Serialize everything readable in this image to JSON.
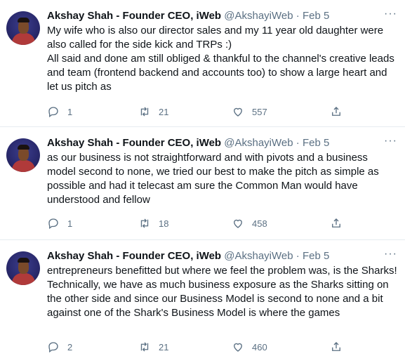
{
  "tweets": [
    {
      "name": "Akshay Shah - Founder CEO, iWeb",
      "handle": "@AkshayiWeb",
      "separator": "·",
      "date": "Feb 5",
      "lines": [
        "My wife who is also our director sales and my 11 year old daughter were also called for the side kick and TRPs :)",
        "All said and done am still obliged & thankful to the channel's creative leads and team (frontend backend and accounts too) to show a large heart and let us pitch as"
      ],
      "replies": "1",
      "retweets": "21",
      "likes": "557"
    },
    {
      "name": "Akshay Shah - Founder CEO, iWeb",
      "handle": "@AkshayiWeb",
      "separator": "·",
      "date": "Feb 5",
      "lines": [
        "as our business is not straightforward and with pivots and a business model second to none, we tried our best to make the pitch as simple as possible and had it telecast am sure the Common Man would have understood and fellow"
      ],
      "replies": "1",
      "retweets": "18",
      "likes": "458"
    },
    {
      "name": "Akshay Shah - Founder CEO, iWeb",
      "handle": "@AkshayiWeb",
      "separator": "·",
      "date": "Feb 5",
      "lines": [
        "entrepreneurs benefitted but where we feel the problem was, is the Sharks!",
        "Technically, we have as much business exposure as the Sharks sitting on the other side and since our Business Model is second to none and a bit against one of the Shark's Business Model is where the games"
      ],
      "replies": "2",
      "retweets": "21",
      "likes": "460"
    }
  ],
  "icons": {
    "more": "more-icon",
    "reply": "reply-icon",
    "retweet": "retweet-icon",
    "like": "heart-icon",
    "share": "share-icon"
  },
  "colors": {
    "secondary_text": "#5b7083",
    "divider": "#e6ecf0"
  }
}
